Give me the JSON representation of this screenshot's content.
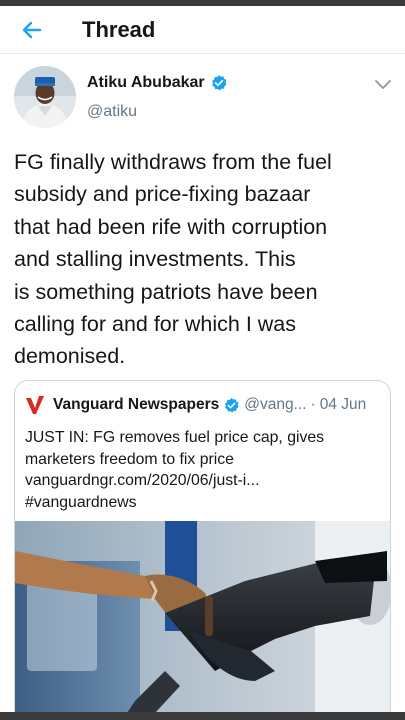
{
  "header": {
    "title": "Thread",
    "back_icon": "arrow-left-icon",
    "accent": "#1da1f2"
  },
  "author": {
    "name": "Atiku Abubakar",
    "handle": "@atiku",
    "verified": true,
    "verified_color": "#1da1f2"
  },
  "tweet": {
    "text": "FG finally withdraws from the fuel\nsubsidy and price-fixing bazaar\nthat had been rife with corruption\nand stalling investments. This\nis something patriots have been\ncalling for and for which I was\ndemonised."
  },
  "quoted_tweet": {
    "name": "Vanguard Newspapers",
    "handle": "@vang...",
    "separator": "·",
    "date": "04 Jun",
    "verified": true,
    "logo_color": "#d62b20",
    "text": "JUST IN: FG removes fuel price cap, gives\nmarketers freedom to fix price\nvanguardngr.com/2020/06/just-i...\n#vanguardnews",
    "image": "fuel-pump-nozzle-photo"
  }
}
